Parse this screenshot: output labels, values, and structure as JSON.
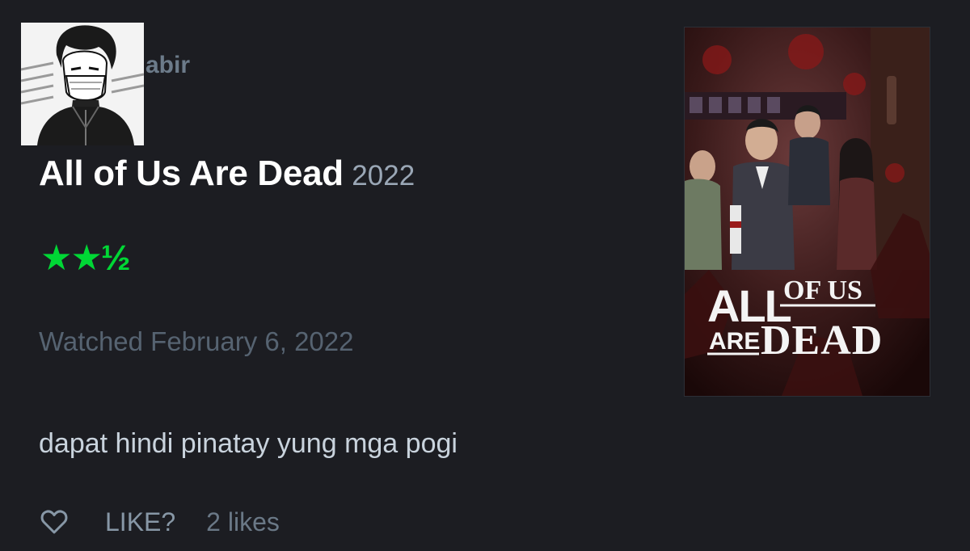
{
  "user": {
    "username_partial": "abir",
    "avatar_icon": "manga-avatar-icon"
  },
  "film": {
    "title": "All of Us Are Dead",
    "year": "2022",
    "rating_display": "★★½",
    "rating_value": 2.5,
    "rating_max": 5,
    "rating_color": "#00d735",
    "poster_title_line1_part1": "ALL",
    "poster_title_line1_part2": "OF US",
    "poster_title_line2_part1": "ARE",
    "poster_title_line2_part2": "DEAD"
  },
  "watched": "Watched February 6, 2022",
  "review": "dapat hindi pinatay yung mga pogi",
  "actions": {
    "heart_icon": "heart-outline-icon",
    "like_label": "LIKE?",
    "likes_count": "2 likes"
  },
  "colors": {
    "background": "#1c1d22",
    "title": "#ffffff",
    "year": "#9aa7b6",
    "muted": "#566371",
    "review": "#c9d3dd"
  }
}
